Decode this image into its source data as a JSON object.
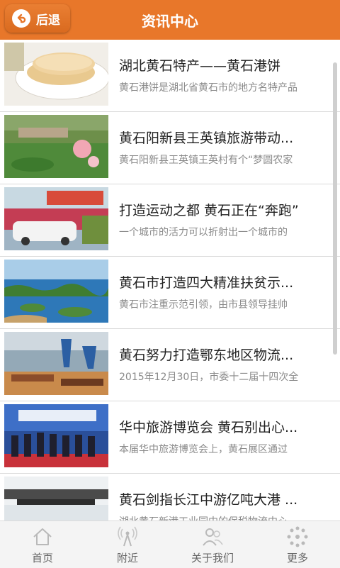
{
  "header": {
    "back_label": "后退",
    "title": "资讯中心"
  },
  "items": [
    {
      "title": "湖北黄石特产——黄石港饼",
      "summary": "黄石港饼是湖北省黄石市的地方名特产品"
    },
    {
      "title": "黄石阳新县王英镇旅游带动...",
      "summary": "黄石阳新县王英镇王英村有个“梦圆农家"
    },
    {
      "title": "打造运动之都 黄石正在“奔跑”",
      "summary": "一个城市的活力可以折射出一个城市的"
    },
    {
      "title": "黄石市打造四大精准扶贫示...",
      "summary": "黄石市注重示范引领，由市县领导挂帅"
    },
    {
      "title": "黄石努力打造鄂东地区物流...",
      "summary": "2015年12月30日，市委十二届十四次全"
    },
    {
      "title": "华中旅游博览会 黄石别出心...",
      "summary": "本届华中旅游博览会上，黄石展区通过"
    },
    {
      "title": "黄石剑指长江中游亿吨大港 ...",
      "summary": "湖北黄石新港工业园中的保税物流中心"
    }
  ],
  "tabbar": [
    {
      "label": "首页",
      "icon": "home-icon"
    },
    {
      "label": "附近",
      "icon": "signal-tower-icon"
    },
    {
      "label": "关于我们",
      "icon": "people-icon"
    },
    {
      "label": "更多",
      "icon": "more-dots-icon"
    }
  ],
  "colors": {
    "header": "#e8772a",
    "tab_text": "#666666"
  }
}
